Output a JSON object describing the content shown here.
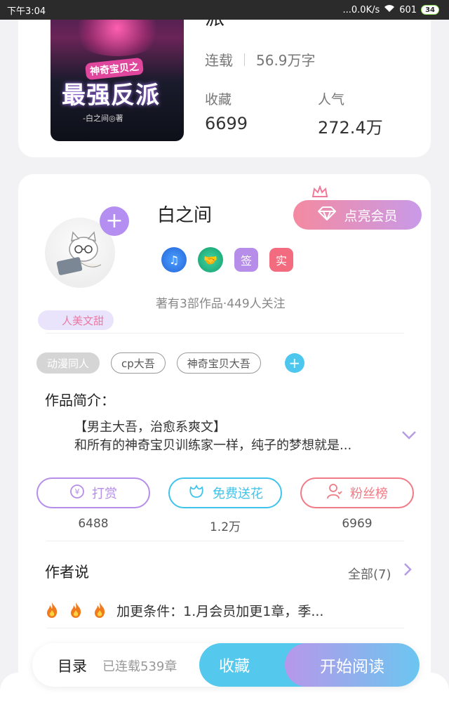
{
  "status_bar": {
    "time": "下午3:04",
    "network": "...0.0K/s",
    "signal": "601",
    "battery": "34"
  },
  "book": {
    "cover_subtitle": "神奇宝贝之",
    "cover_title": "最强反派",
    "cover_author": "-白之间◎著",
    "title_fragment": "派",
    "status": "连载",
    "word_count": "56.9万字",
    "favorites_label": "收藏",
    "favorites_value": "6699",
    "popularity_label": "人气",
    "popularity_value": "272.4万"
  },
  "author": {
    "name": "白之间",
    "follow_symbol": "+",
    "vip_button": "点亮会员",
    "fan_tag": "人美文甜",
    "badges": [
      {
        "icon": "music-note-icon",
        "color": "#3b8cf0"
      },
      {
        "icon": "handshake-icon",
        "color": "#2fc08e"
      },
      {
        "label": "签",
        "color": "#b68ee9"
      },
      {
        "label": "实",
        "color": "#f26b7f"
      }
    ],
    "stats": "著有3部作品·449人关注"
  },
  "tags": [
    "动漫同人",
    "cp大吾",
    "神奇宝贝大吾"
  ],
  "intro": {
    "title": "作品简介：",
    "line1": "【男主大吾，治愈系爽文】",
    "line2": "和所有的神奇宝贝训练家一样，纯子的梦想就是..."
  },
  "actions": [
    {
      "label": "打赏",
      "count": "6488",
      "color": "#b68ee9",
      "icon": "yen-coin-icon"
    },
    {
      "label": "免费送花",
      "count": "1.2万",
      "color": "#3fc3ea",
      "icon": "flower-icon"
    },
    {
      "label": "粉丝榜",
      "count": "6969",
      "color": "#f07a85",
      "icon": "fans-icon"
    }
  ],
  "author_says": {
    "title": "作者说",
    "all_label": "全部(7)",
    "text": "加更条件：1.月会员加更1章，季..."
  },
  "bottom_bar": {
    "toc_label": "目录",
    "chapters": "已连载539章",
    "favorite_button": "收藏",
    "read_button": "开始阅读"
  }
}
